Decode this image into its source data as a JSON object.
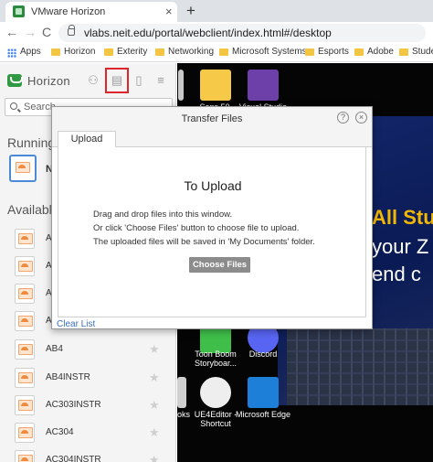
{
  "browser": {
    "tab_title": "VMware Horizon",
    "tab_close": "×",
    "new_tab": "+",
    "back": "←",
    "forward": "→",
    "reload": "C",
    "url": "vlabs.neit.edu/portal/webclient/index.html#/desktop",
    "bookmarks": [
      "Apps",
      "Horizon",
      "Exterity",
      "Networking",
      "Microsoft Systems",
      "Esports",
      "Adobe",
      "Studen"
    ]
  },
  "sidebar": {
    "title": "Horizon",
    "search_placeholder": "Search",
    "running_heading": "Running",
    "running_label": "N",
    "available_heading": "Available",
    "toolbar_glyphs": [
      "⚇",
      "▤",
      "▯",
      "≡"
    ],
    "apps": [
      "A",
      "A",
      "A",
      "A",
      "AB4",
      "AB4INSTR",
      "AC303INSTR",
      "AC304",
      "AC304INSTR"
    ],
    "star": "★"
  },
  "desktop": {
    "icons": [
      {
        "label": "",
        "color": "#f7c948"
      },
      {
        "label": "",
        "color": "#6d3fa8"
      },
      {
        "label": "",
        "color": "#c9c9c9"
      },
      {
        "label": "Toon Boom Storyboar...",
        "color": "#3fbf4a"
      },
      {
        "label": "Discord",
        "color": "#5865f2"
      },
      {
        "label": "UE4Editor - Shortcut",
        "color": "#eeeeee"
      },
      {
        "label": "Microsoft Edge",
        "color": "#1e7fd9"
      },
      {
        "label": "ooks",
        "color": "#d0d0d0"
      }
    ],
    "partial_labels": [
      "Sans 50",
      "Visual Studio"
    ],
    "banner_lines": [
      "All Stu",
      "your Z",
      "end c"
    ]
  },
  "dialog": {
    "title": "Transfer Files",
    "help": "?",
    "close": "×",
    "tab": "Upload",
    "heading": "To Upload",
    "instructions": [
      "Drag and drop files into this window.",
      "Or click 'Choose Files' button to choose file to upload.",
      "The uploaded files will be saved in 'My Documents' folder."
    ],
    "choose_button": "Choose Files",
    "clear_list": "Clear List"
  }
}
